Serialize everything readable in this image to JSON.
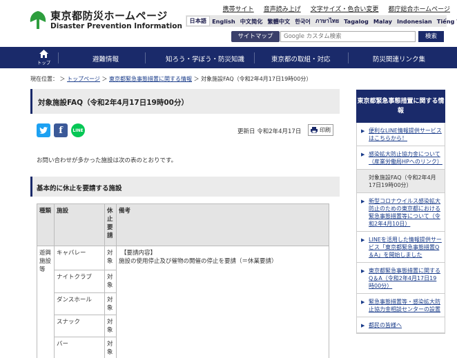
{
  "header": {
    "logo_ja": "東京都防災ホームページ",
    "logo_en": "Disaster Prevention Information",
    "util_links": [
      "携帯サイト",
      "音声読み上げ",
      "文字サイズ・色合い変更",
      "都庁総合ホームページ"
    ],
    "languages": [
      "日本語",
      "English",
      "中文简化",
      "繁體中文",
      "한국어",
      "ภาษาไทย",
      "Tagalog",
      "Malay",
      "Indonesian",
      "Tiếng Việt"
    ],
    "sitemap_label": "サイトマップ",
    "search_placeholder": "Google カスタム検索",
    "search_button": "検索"
  },
  "nav": {
    "home_label": "トップ",
    "items": [
      "避難情報",
      "知ろう・学ぼう・防災知識",
      "東京都の取組・対応",
      "防災関連リンク集"
    ]
  },
  "breadcrumb": {
    "prefix": "現在位置：",
    "links": [
      "トップページ",
      "東京都緊急事態措置に関する情報"
    ],
    "current": "対象施設FAQ（令和2年4月17日19時00分）",
    "sep": "＞"
  },
  "main": {
    "title": "対象施設FAQ（令和2年4月17日19時00分）",
    "share_line": "LINE",
    "updated": "更新日 令和2年4月17日",
    "print_label": "印刷",
    "intro": "お問い合わせが多かった施設は次の表のとおりです。",
    "section_title": "基本的に休止を要請する施設",
    "table": {
      "headers": [
        "種類",
        "施設",
        "休止要請",
        "備考"
      ],
      "category": "遊興施設等",
      "rows": [
        {
          "facility": "キャバレー",
          "status": "対象"
        },
        {
          "facility": "ナイトクラブ",
          "status": "対象"
        },
        {
          "facility": "ダンスホール",
          "status": "対象"
        },
        {
          "facility": "スナック",
          "status": "対象"
        },
        {
          "facility": "バー",
          "status": "対象"
        }
      ],
      "note_head": "【要請内容】",
      "note_body": "施設の使用停止及び催物の開催の停止を要請（＝休業要請）"
    }
  },
  "sidebar": {
    "heading": "東京都緊急事態措置に関する情報",
    "items": [
      "便利なLINE情報提供サービスはこちらから！",
      "感染拡大防止協力金について（産業労働局HPへのリンク）",
      "対象施設FAQ（令和2年4月17日19時00分）",
      "新型コロナウイルス感染拡大防止のための東京都における緊急事態措置等について（令和2年4月10日）",
      "LINEを活用した情報提供サービス「東京都緊急事態措置Q＆A」を開始しました",
      "東京都緊急事態措置に関するQ＆A（令和2年4月17日19時00分）",
      "緊急事態措置等・感染拡大防止協力金相談センターの設置",
      "都民の皆様へ"
    ],
    "current_index": 2
  }
}
